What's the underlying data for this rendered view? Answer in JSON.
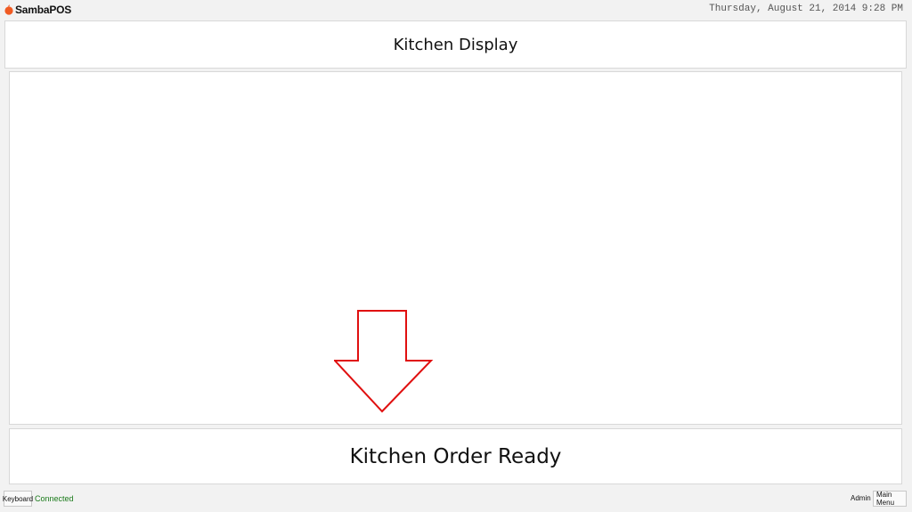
{
  "app": {
    "logo_text": "SambaPOS",
    "datetime": "Thursday, August 21, 2014 9:28 PM"
  },
  "header": {
    "title": "Kitchen Display"
  },
  "display_area": {
    "annotation_arrow_color": "#e01010"
  },
  "action": {
    "ready_label": "Kitchen Order Ready"
  },
  "statusbar": {
    "keyboard_label": "Keyboard",
    "connection_status": "Connected",
    "connection_color": "#1a7a1a",
    "user": "Admin",
    "main_menu_label": "Main Menu"
  },
  "colors": {
    "logo_accent": "#f05a22"
  }
}
